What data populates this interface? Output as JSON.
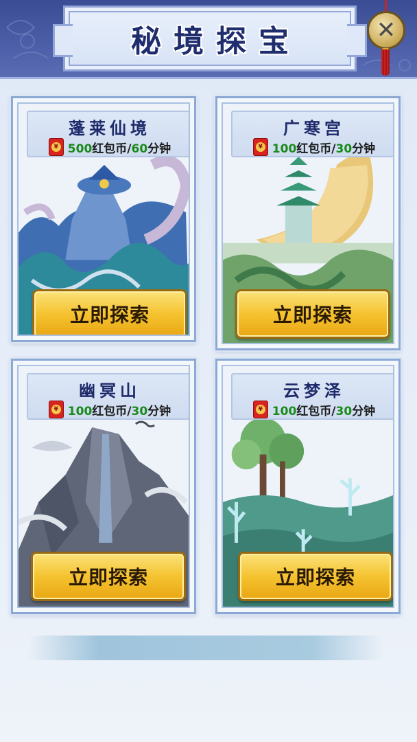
{
  "title": "秘境探宝",
  "close_label": "✕",
  "explore_label": "立即探索",
  "cards": [
    {
      "name": "蓬莱仙境",
      "cost": "500",
      "currency": "红包币/",
      "minutes": "60",
      "unit": "分钟"
    },
    {
      "name": "广寒宫",
      "cost": "100",
      "currency": "红包币/",
      "minutes": "30",
      "unit": "分钟"
    },
    {
      "name": "幽冥山",
      "cost": "100",
      "currency": "红包币/",
      "minutes": "30",
      "unit": "分钟"
    },
    {
      "name": "云梦泽",
      "cost": "100",
      "currency": "红包币/",
      "minutes": "30",
      "unit": "分钟"
    }
  ],
  "colors": {
    "header_bg": "#4c5fa8",
    "title_text": "#1f2d6e",
    "button_gold": "#f5c330",
    "cost_number": "#1a8a1a"
  }
}
